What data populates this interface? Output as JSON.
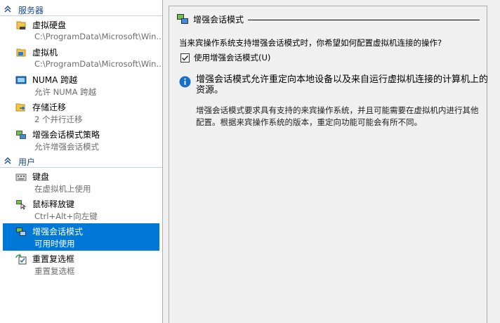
{
  "nav": {
    "server_section": "服务器",
    "user_section": "用户",
    "server_items": [
      {
        "title": "虚拟硬盘",
        "sub": "C:\\ProgramData\\Microsoft\\Win..."
      },
      {
        "title": "虚拟机",
        "sub": "C:\\ProgramData\\Microsoft\\Win..."
      },
      {
        "title": "NUMA 跨越",
        "sub": "允许 NUMA 跨越"
      },
      {
        "title": "存储迁移",
        "sub": "2 个并行迁移"
      },
      {
        "title": "增强会话模式策略",
        "sub": "允许增强会话模式"
      }
    ],
    "user_items": [
      {
        "title": "键盘",
        "sub": "在虚拟机上使用"
      },
      {
        "title": "鼠标释放键",
        "sub": "Ctrl+Alt+向左键"
      },
      {
        "title": "增强会话模式",
        "sub": "可用时使用"
      },
      {
        "title": "重置复选框",
        "sub": "重置复选框"
      }
    ],
    "selected_item": "增强会话模式"
  },
  "panel": {
    "title": "增强会话模式",
    "question": "当来宾操作系统支持增强会话模式时，你希望如何配置虚拟机连接的操作?",
    "checkbox_label": "使用增强会话模式(U)",
    "checkbox_checked": true,
    "info_text": "增强会话模式允许重定向本地设备以及来自运行虚拟机连接的计算机上的资源。",
    "description": "增强会话模式要求具有支持的来宾操作系统，并且可能需要在虚拟机内进行其他配置。根据来宾操作系统的版本，重定向功能可能会有所不同。"
  },
  "icons": {
    "disk": "virtual-disk-icon",
    "vm": "virtual-machine-icon",
    "numa": "numa-icon",
    "storage": "storage-migration-icon",
    "session_policy": "enhanced-session-policy-icon",
    "keyboard": "keyboard-icon",
    "mouse": "mouse-release-icon",
    "session": "enhanced-session-icon",
    "reset": "reset-checkbox-icon",
    "info": "info-icon"
  },
  "colors": {
    "selection": "#0078d7",
    "section_text": "#1a4a8a",
    "sub_text": "#6d6d6d"
  }
}
